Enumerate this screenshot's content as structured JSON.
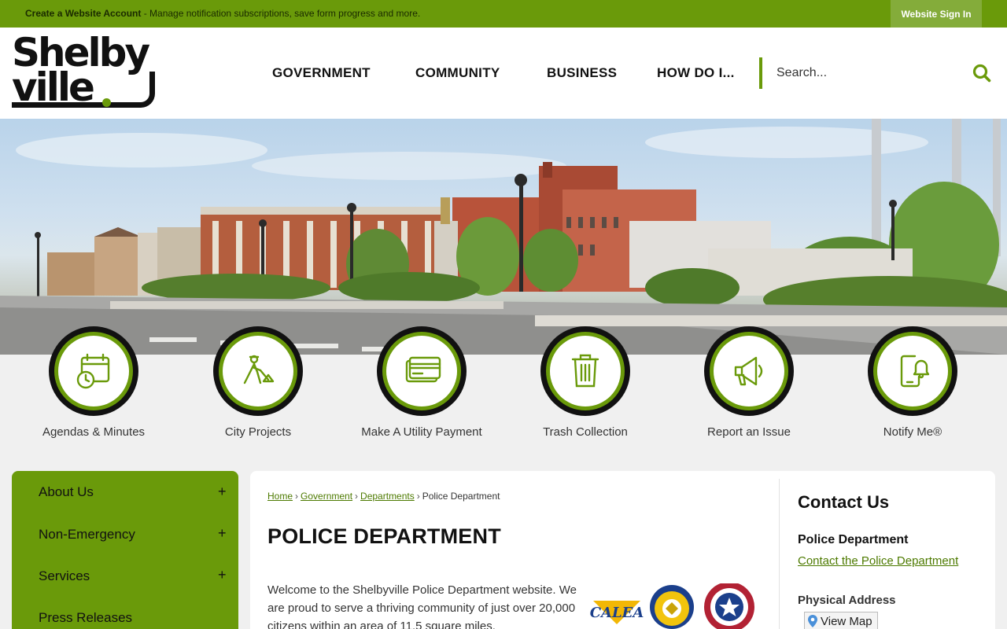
{
  "topbar": {
    "create_account": "Create a Website Account",
    "message": " - Manage notification subscriptions, save form progress and more.",
    "sign_in": "Website Sign In"
  },
  "logo": {
    "line1": "Shelby",
    "line2": "ville"
  },
  "nav": [
    {
      "label": "GOVERNMENT"
    },
    {
      "label": "COMMUNITY"
    },
    {
      "label": "BUSINESS"
    },
    {
      "label": "HOW DO I..."
    }
  ],
  "search": {
    "placeholder": "Search..."
  },
  "quick_links": [
    {
      "label": "Agendas & Minutes",
      "icon": "calendar-clock-icon"
    },
    {
      "label": "City Projects",
      "icon": "construction-worker-icon"
    },
    {
      "label": "Make A Utility Payment",
      "icon": "credit-card-icon"
    },
    {
      "label": "Trash Collection",
      "icon": "trash-can-icon"
    },
    {
      "label": "Report an Issue",
      "icon": "megaphone-icon"
    },
    {
      "label": "Notify Me®",
      "icon": "phone-bell-icon"
    }
  ],
  "sidenav": [
    {
      "label": "About Us",
      "expand": "+"
    },
    {
      "label": "Non-Emergency",
      "expand": "+"
    },
    {
      "label": "Services",
      "expand": "+"
    },
    {
      "label": "Press Releases",
      "expand": ""
    }
  ],
  "breadcrumb": {
    "home": "Home",
    "government": "Government",
    "departments": "Departments",
    "current": "Police Department",
    "sep": "›"
  },
  "page": {
    "title": "POLICE DEPARTMENT",
    "intro": "Welcome to the Shelbyville Police Department website. We are proud to serve a thriving community of just over 20,000 citizens within an area of 11.5 square miles."
  },
  "badges": {
    "calea": "CALEA"
  },
  "contact": {
    "heading": "Contact Us",
    "department": "Police Department",
    "link": "Contact the Police Department",
    "address_label": "Physical Address",
    "view_map": "View Map"
  },
  "colors": {
    "brand_green": "#6a9a0a",
    "link_green": "#4d7a00",
    "dark": "#111111"
  }
}
